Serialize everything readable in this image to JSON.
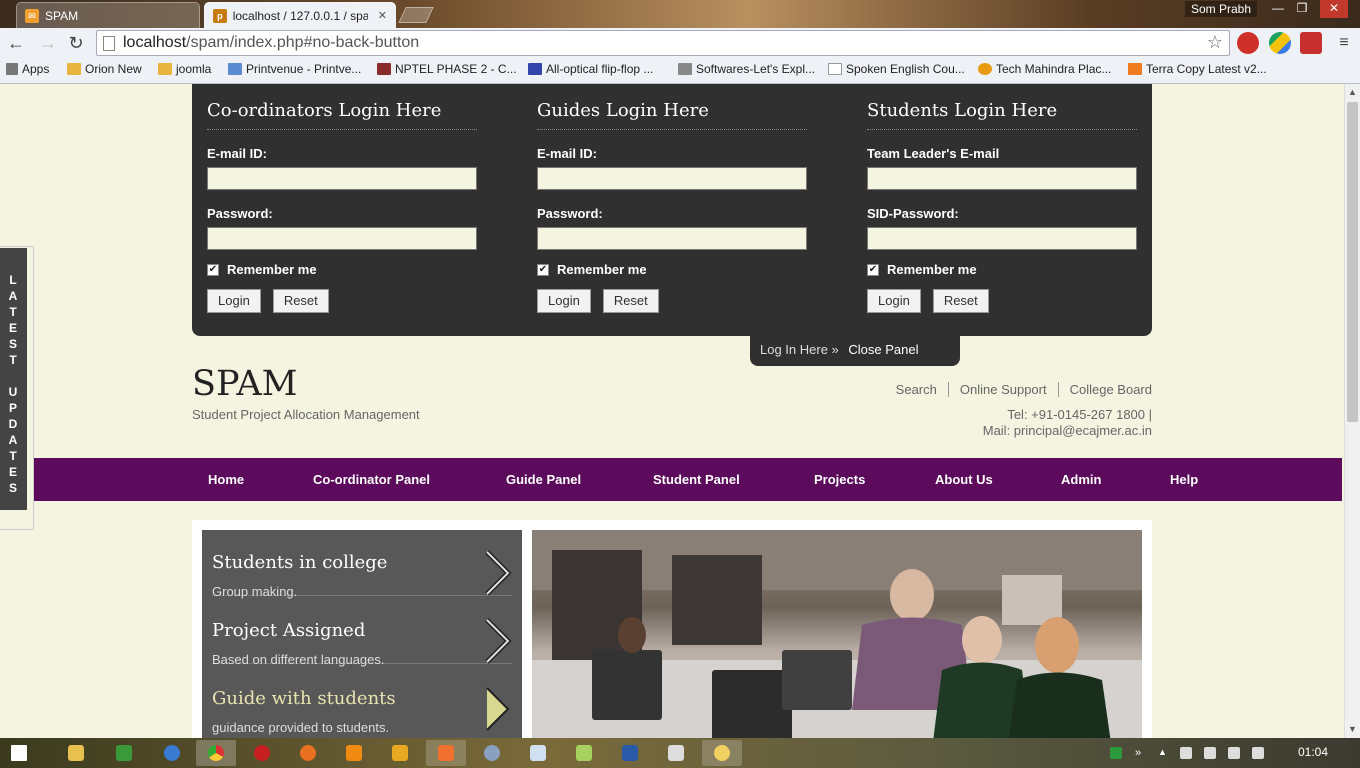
{
  "browser": {
    "user_name": "Som Prabh",
    "tabs": [
      {
        "title": "SPAM"
      },
      {
        "title": "localhost / 127.0.0.1 / spa"
      }
    ],
    "url_host": "localhost",
    "url_path": "/spam/index.php#no-back-button",
    "bookmarks": [
      "Apps",
      "Orion New",
      "joomla",
      "Printvenue - Printve...",
      "NPTEL PHASE 2 - C...",
      "All-optical flip-flop ...",
      "Softwares-Let's Expl...",
      "Spoken English Cou...",
      "Tech Mahindra Plac...",
      "Terra Copy Latest v2..."
    ]
  },
  "login_panel": {
    "columns": [
      {
        "title": "Co-ordinators Login Here",
        "field1_label": "E-mail ID:",
        "field2_label": "Password:",
        "remember": "Remember me",
        "login": "Login",
        "reset": "Reset"
      },
      {
        "title": "Guides Login Here",
        "field1_label": "E-mail ID:",
        "field2_label": "Password:",
        "remember": "Remember me",
        "login": "Login",
        "reset": "Reset"
      },
      {
        "title": "Students Login Here",
        "field1_label": "Team Leader's E-mail",
        "field2_label": "SID-Password:",
        "remember": "Remember me",
        "login": "Login",
        "reset": "Reset"
      }
    ],
    "tab_text": "Log In Here »",
    "close_text": "Close Panel"
  },
  "latest_updates": "L\nA\nT\nE\nS\nT\n \nU\nP\nD\nA\nT\nE\nS",
  "header": {
    "logo": "SPAM",
    "tagline": "Student Project Allocation Management",
    "links": [
      "Search",
      "Online Support",
      "College Board"
    ],
    "tel": "Tel: +91-0145-267 1800 |",
    "mail": "Mail: principal@ecajmer.ac.in"
  },
  "menu": [
    "Home",
    "Co-ordinator Panel",
    "Guide Panel",
    "Student Panel",
    "Projects",
    "About Us",
    "Admin",
    "Help"
  ],
  "slides": [
    {
      "title": "Students in college",
      "desc": "Group making."
    },
    {
      "title": "Project Assigned",
      "desc": "Based on different languages."
    },
    {
      "title": "Guide with students",
      "desc": "guidance provided to students."
    }
  ],
  "taskbar": {
    "time": "01:04"
  },
  "colors": {
    "menu_bar": "#5c0a5c",
    "panel": "#303030",
    "page_bg": "#f4f5e1"
  }
}
